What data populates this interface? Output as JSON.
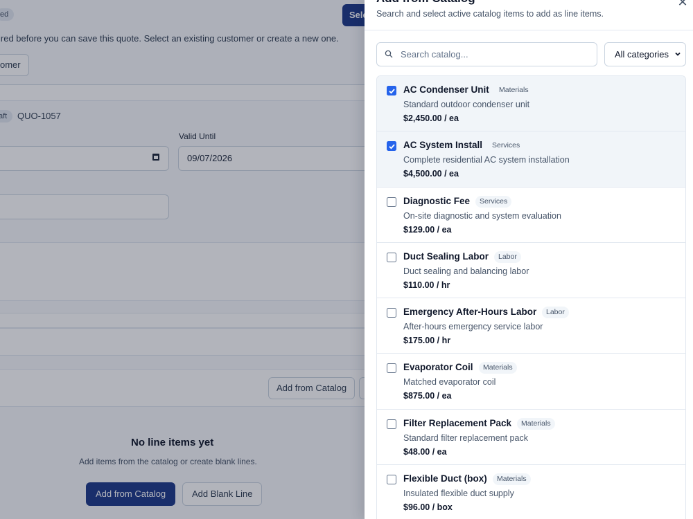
{
  "quote_page": {
    "status_badge": "ed",
    "select_button": "Sele",
    "customer_notice": "ired before you can save this quote. Select an existing customer or create a new one.",
    "new_customer_button": "omer",
    "draft_badge": "aft",
    "quote_number": "QUO-1057",
    "valid_until_label": "Valid Until",
    "valid_until_value": "09/07/2026",
    "add_from_catalog_toolbar": "Add from Catalog",
    "empty_title": "No line items yet",
    "empty_sub": "Add items from the catalog or create blank lines.",
    "empty_add_catalog": "Add from Catalog",
    "empty_add_blank": "Add Blank Line"
  },
  "drawer": {
    "title": "Add from Catalog",
    "subtitle": "Search and select active catalog items to add as line items.",
    "close_icon": "close-icon",
    "search_placeholder": "Search catalog...",
    "category_filter": "All categories",
    "items": [
      {
        "name": "AC Condenser Unit",
        "category": "Materials",
        "description": "Standard outdoor condenser unit",
        "price": "$2,450.00 / ea",
        "checked": true
      },
      {
        "name": "AC System Install",
        "category": "Services",
        "description": "Complete residential AC system installation",
        "price": "$4,500.00 / ea",
        "checked": true
      },
      {
        "name": "Diagnostic Fee",
        "category": "Services",
        "description": "On-site diagnostic and system evaluation",
        "price": "$129.00 / ea",
        "checked": false
      },
      {
        "name": "Duct Sealing Labor",
        "category": "Labor",
        "description": "Duct sealing and balancing labor",
        "price": "$110.00 / hr",
        "checked": false
      },
      {
        "name": "Emergency After-Hours Labor",
        "category": "Labor",
        "description": "After-hours emergency service labor",
        "price": "$175.00 / hr",
        "checked": false
      },
      {
        "name": "Evaporator Coil",
        "category": "Materials",
        "description": "Matched evaporator coil",
        "price": "$875.00 / ea",
        "checked": false
      },
      {
        "name": "Filter Replacement Pack",
        "category": "Materials",
        "description": "Standard filter replacement pack",
        "price": "$48.00 / ea",
        "checked": false
      },
      {
        "name": "Flexible Duct (box)",
        "category": "Materials",
        "description": "Insulated flexible duct supply",
        "price": "$96.00 / box",
        "checked": false
      }
    ]
  },
  "colors": {
    "primary": "#1e3a8a",
    "checkbox_checked": "#2563eb",
    "overlay": "#0f172a"
  }
}
